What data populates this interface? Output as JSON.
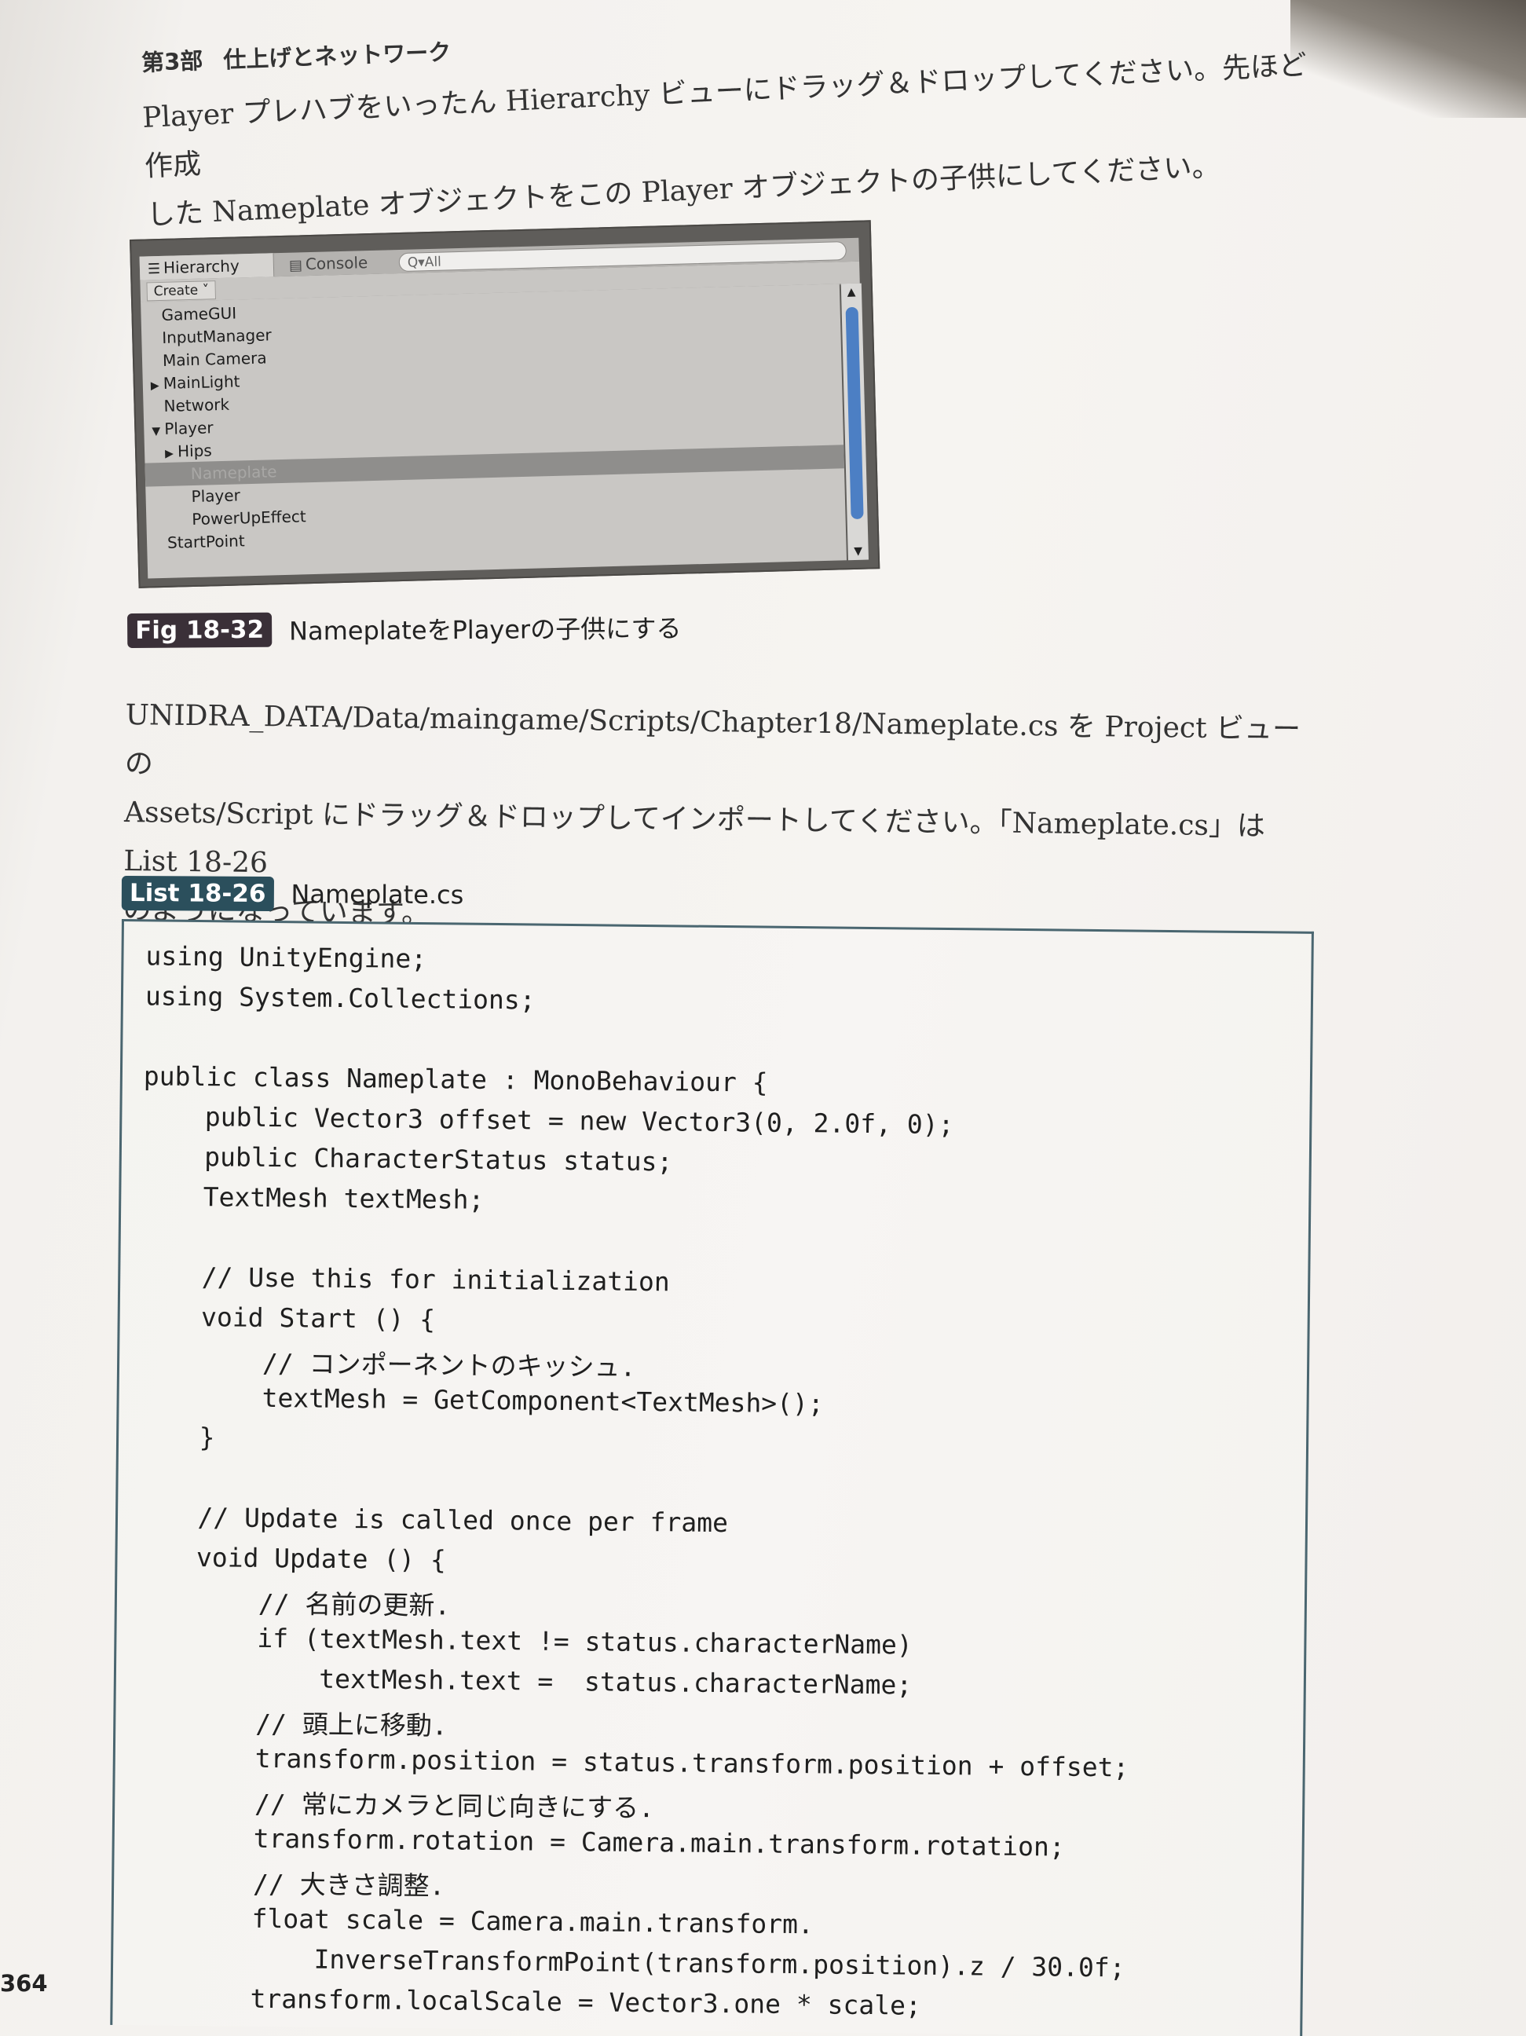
{
  "header": {
    "part_number": "第3部",
    "part_title": "仕上げとネットワーク"
  },
  "paragraph_1": "Player プレハブをいったん Hierarchy ビューにドラッグ＆ドロップしてください。先ほど作成\nした Nameplate オブジェクトをこの Player オブジェクトの子供にしてください。",
  "unity_window": {
    "tabs": [
      {
        "label": "Hierarchy",
        "icon": "list-icon"
      },
      {
        "label": "Console",
        "icon": "console-icon"
      }
    ],
    "create_button": "Create ˅",
    "search_placeholder": "Q▾All",
    "tree_items": [
      {
        "label": "GameGUI",
        "indent": 0,
        "arrow": ""
      },
      {
        "label": "InputManager",
        "indent": 0,
        "arrow": ""
      },
      {
        "label": "Main Camera",
        "indent": 0,
        "arrow": ""
      },
      {
        "label": "MainLight",
        "indent": 0,
        "arrow": "▶"
      },
      {
        "label": "Network",
        "indent": 0,
        "arrow": ""
      },
      {
        "label": "Player",
        "indent": 0,
        "arrow": "▼"
      },
      {
        "label": "Hips",
        "indent": 1,
        "arrow": "▶"
      },
      {
        "label": "Nameplate",
        "indent": 2,
        "arrow": "",
        "selected": true
      },
      {
        "label": "Player",
        "indent": 2,
        "arrow": ""
      },
      {
        "label": "PowerUpEffect",
        "indent": 2,
        "arrow": ""
      },
      {
        "label": "StartPoint",
        "indent": 0,
        "arrow": ""
      }
    ]
  },
  "figure": {
    "badge": "Fig 18-32",
    "caption": "NameplateをPlayerの子供にする"
  },
  "paragraph_2": "UNIDRA_DATA/Data/maingame/Scripts/Chapter18/Nameplate.cs を Project ビューの\nAssets/Script にドラッグ＆ドロップしてインポートしてください。「Nameplate.cs」は List 18-26\nのようになっています。",
  "listing": {
    "badge": "List 18-26",
    "caption": "Nameplate.cs",
    "lines": [
      "using UnityEngine;",
      "using System.Collections;",
      "",
      "public class Nameplate : MonoBehaviour {",
      "    public Vector3 offset = new Vector3(0, 2.0f, 0);",
      "    public CharacterStatus status;",
      "    TextMesh textMesh;",
      "",
      "    // Use this for initialization",
      "    void Start () {",
      "        // コンポーネントのキッシュ.",
      "        textMesh = GetComponent<TextMesh>();",
      "    }",
      "",
      "    // Update is called once per frame",
      "    void Update () {",
      "        // 名前の更新.",
      "        if (textMesh.text != status.characterName)",
      "            textMesh.text =  status.characterName;",
      "        // 頭上に移動.",
      "        transform.position = status.transform.position + offset;",
      "        // 常にカメラと同じ向きにする.",
      "        transform.rotation = Camera.main.transform.rotation;",
      "        // 大きさ調整.",
      "        float scale = Camera.main.transform.",
      "            InverseTransformPoint(transform.position).z / 30.0f;",
      "        transform.localScale = Vector3.one * scale;"
    ]
  },
  "page_number": "364"
}
